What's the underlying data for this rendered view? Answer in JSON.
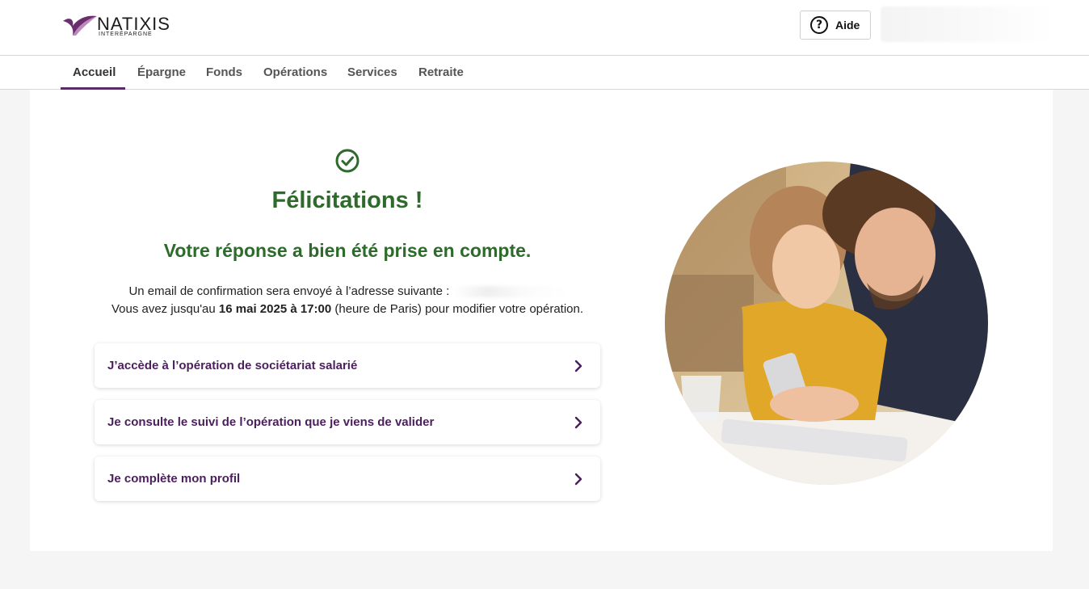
{
  "header": {
    "logo_name": "NATIXIS",
    "logo_sub": "INTERÉPARGNE",
    "help_label": "Aide",
    "help_icon": "question-circle-icon"
  },
  "nav": {
    "items": [
      "Accueil",
      "Épargne",
      "Fonds",
      "Opérations",
      "Services",
      "Retraite"
    ],
    "active": "Accueil"
  },
  "confirmation": {
    "icon": "check-circle-icon",
    "title": "Félicitations !",
    "subtitle": "Votre réponse a bien été prise en compte.",
    "email_text": "Un email de confirmation sera envoyé à l’adresse suivante :",
    "deadline_prefix": "Vous avez jusqu'au",
    "deadline_date": "16 mai 2025 à 17:00",
    "deadline_suffix": "(heure de Paris) pour modifier votre opération."
  },
  "actions": [
    {
      "label": "J’accède à l’opération de sociétariat salarié",
      "icon": "chevron-right-icon"
    },
    {
      "label": "Je consulte le suivi de l’opération que je viens de valider",
      "icon": "chevron-right-icon"
    },
    {
      "label": "Je complète mon profil",
      "icon": "chevron-right-icon"
    }
  ],
  "colors": {
    "success_green": "#2d6a2b",
    "brand_purple": "#4a1f5c",
    "nav_underline": "#5a2a6a",
    "page_bg": "#f5f5f5"
  }
}
